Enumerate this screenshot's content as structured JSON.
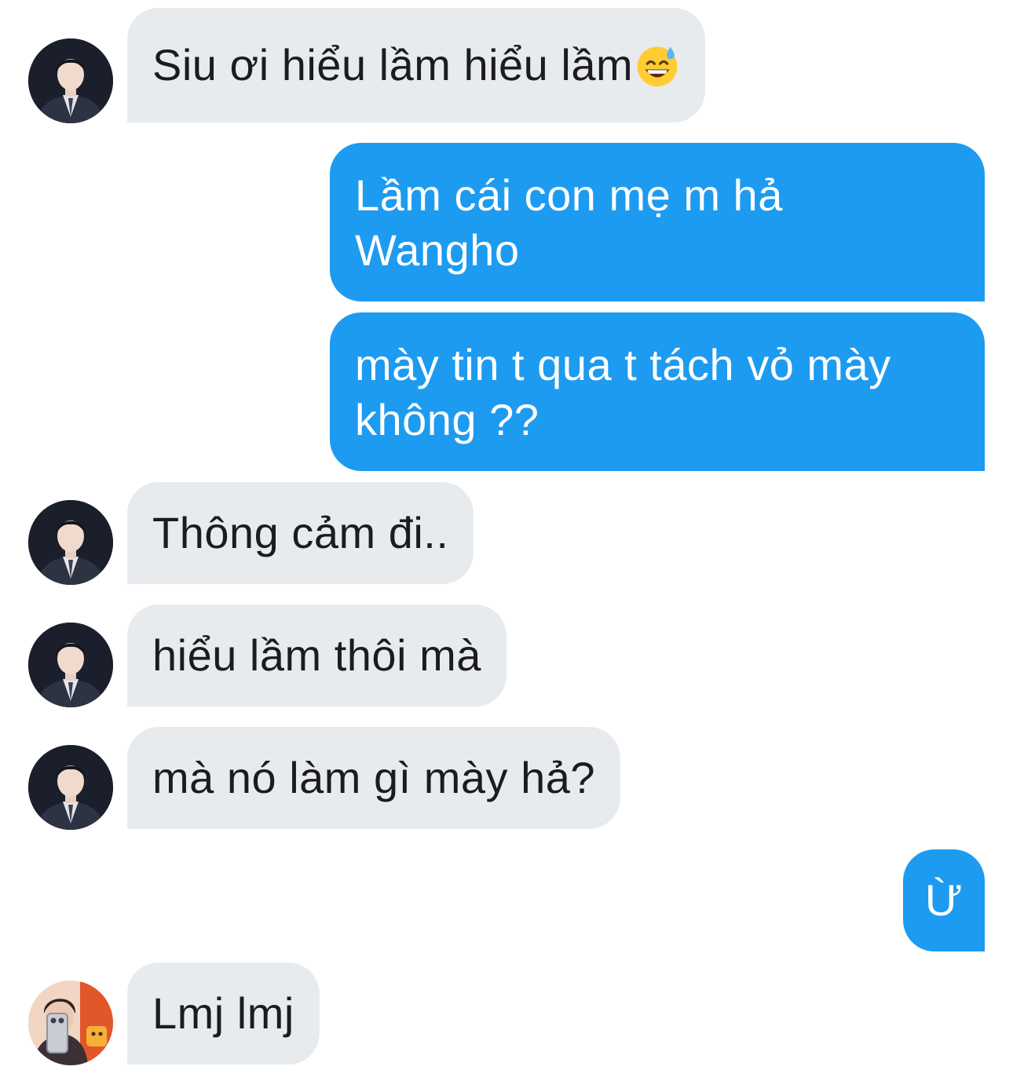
{
  "conversation": {
    "messages": [
      {
        "from": "them",
        "text": "Siu ơi hiểu lầm hiểu lầm",
        "emoji": "grinning-face-with-sweat-emoji"
      },
      {
        "from": "me",
        "lines": [
          "Lầm cái con mẹ m hả",
          "Wangho"
        ]
      },
      {
        "from": "me",
        "lines": [
          "mày tin t qua t tách vỏ mày",
          "không ??"
        ]
      },
      {
        "from": "them",
        "text": "Thông cảm đi.."
      },
      {
        "from": "them",
        "text": "hiểu lầm thôi mà"
      },
      {
        "from": "them",
        "text": "mà nó làm gì mày hả?"
      },
      {
        "from": "me",
        "text": "Ừ"
      },
      {
        "from": "them2",
        "text": "Lmj lmj"
      }
    ]
  },
  "colors": {
    "outgoing_bubble": "#1d9bf0",
    "incoming_bubble": "#e8ebee",
    "incoming_text": "#1c1c1e",
    "outgoing_text": "#ffffff"
  },
  "icons": {
    "avatar_1": "suit-portrait-avatar",
    "avatar_2": "selfie-phone-avatar"
  }
}
